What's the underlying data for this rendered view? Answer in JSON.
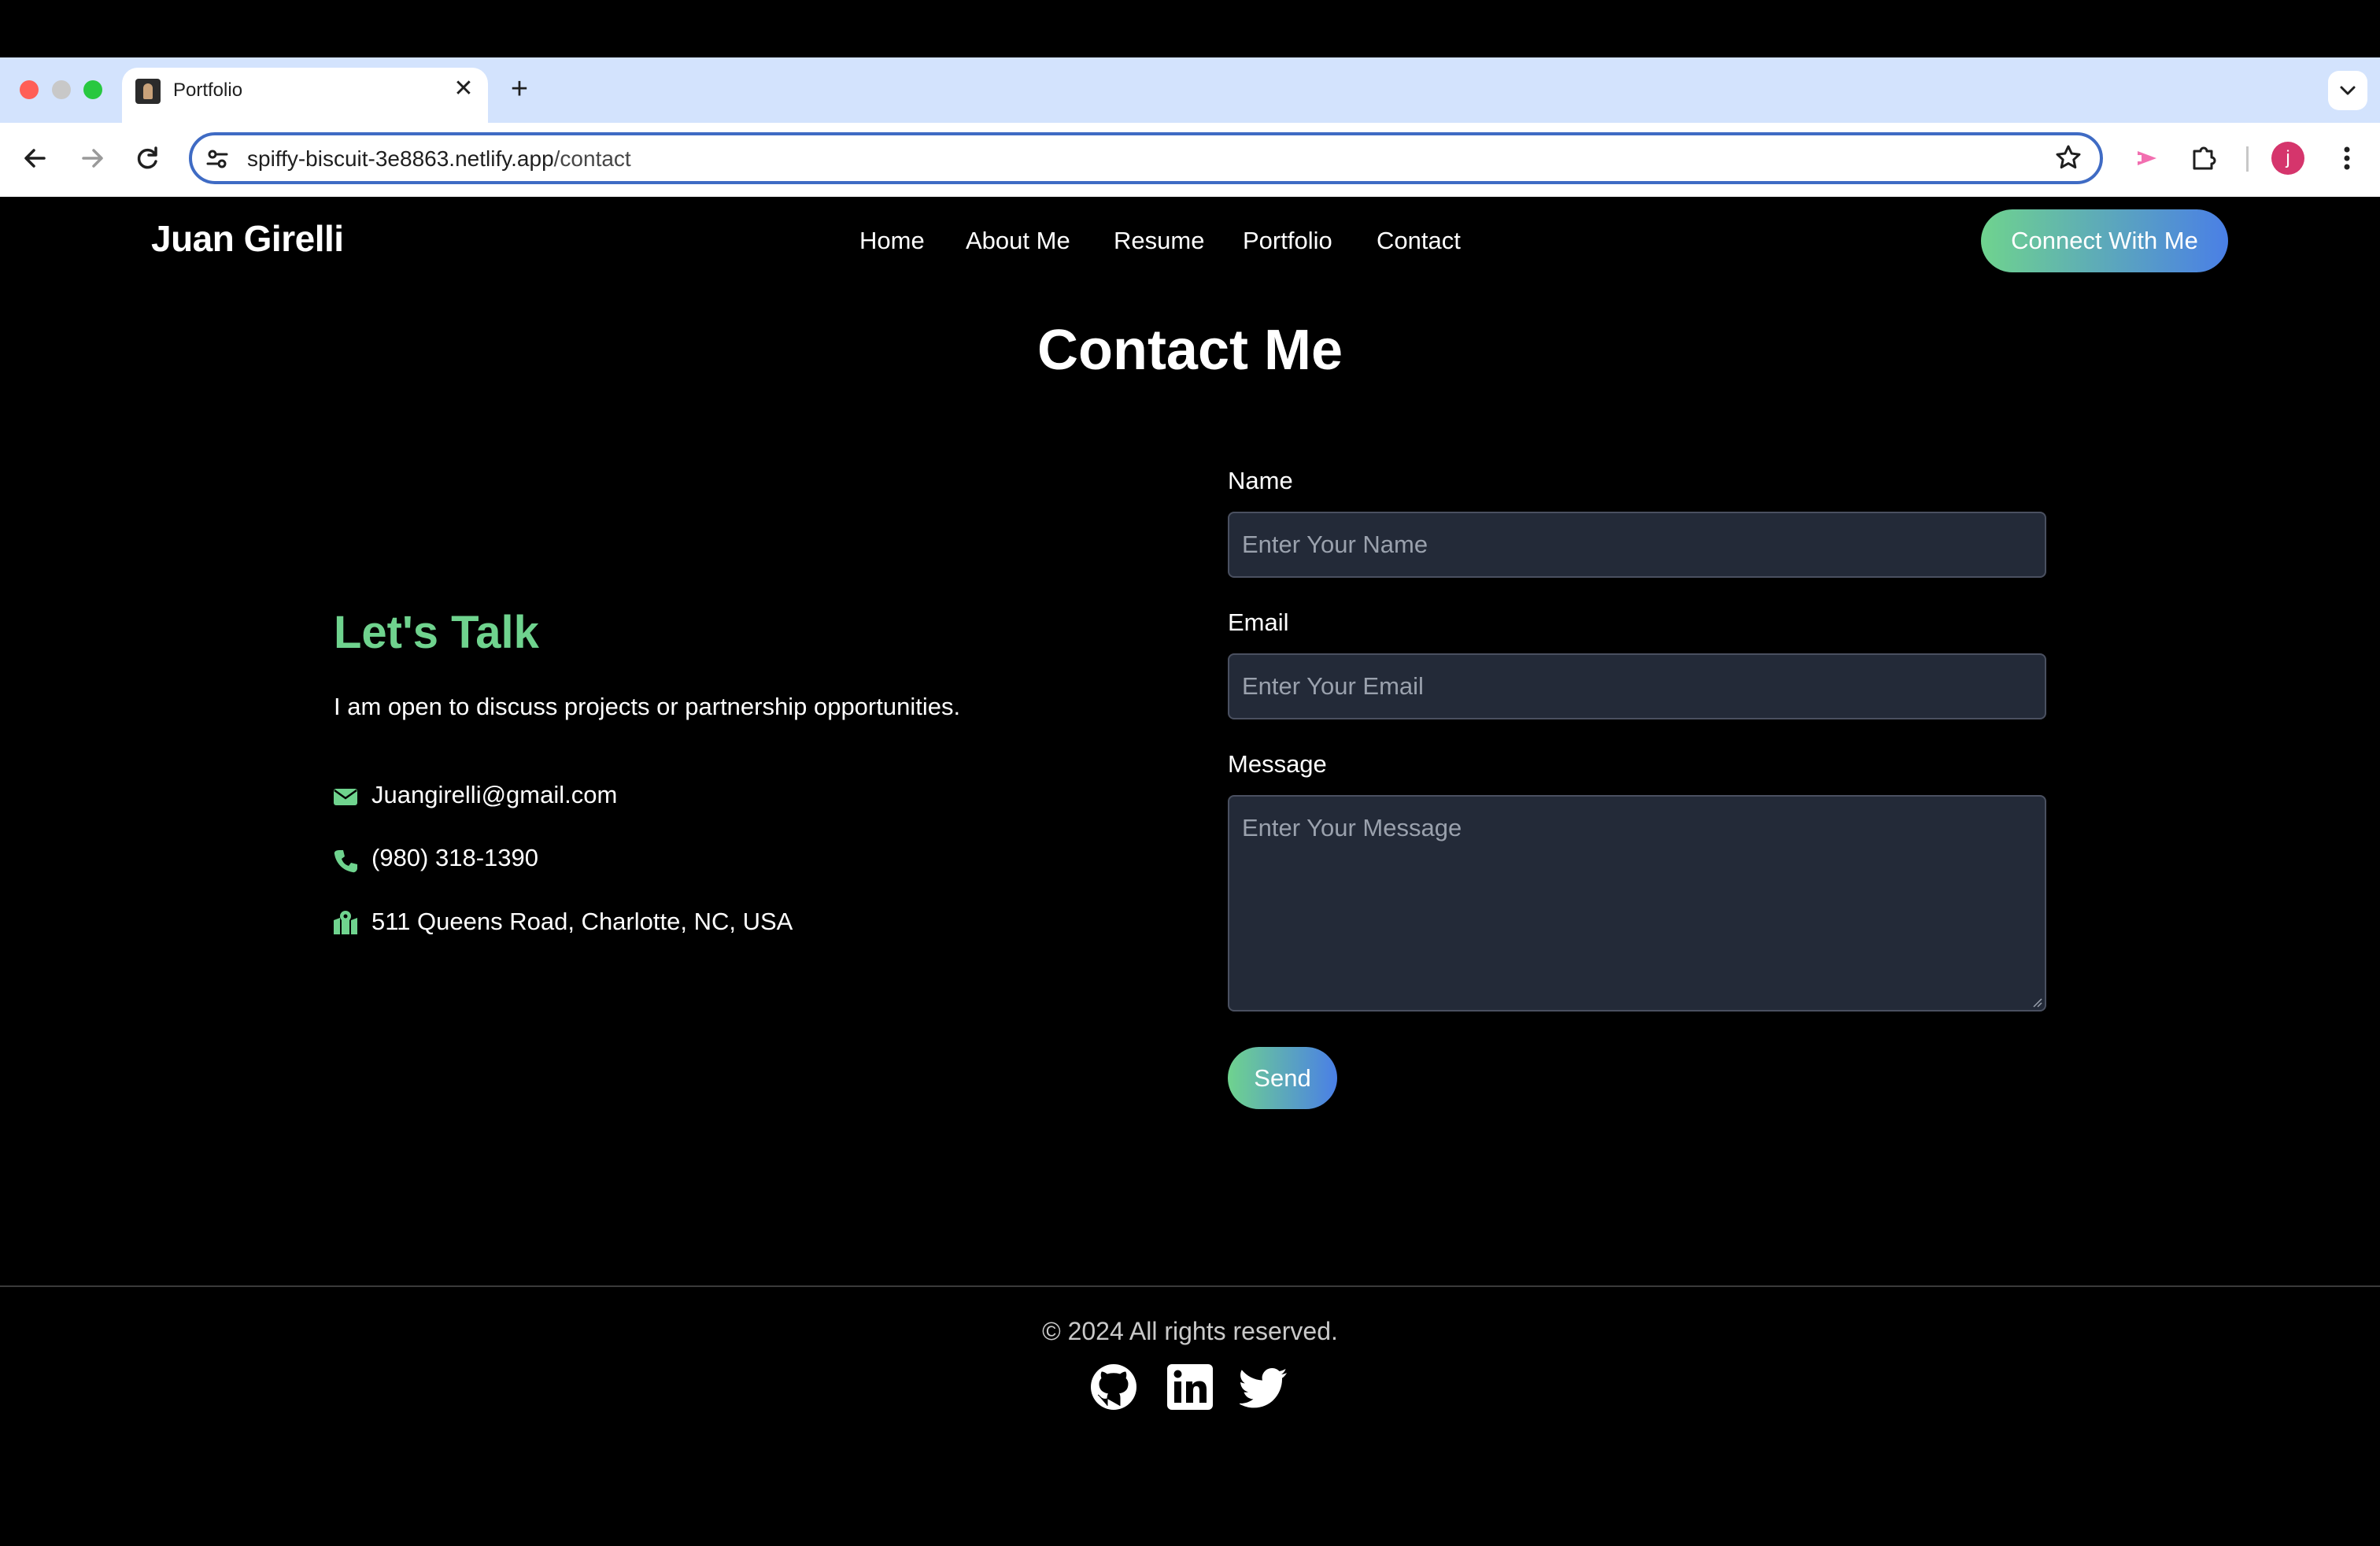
{
  "browser": {
    "tab_title": "Portfolio",
    "close_glyph": "✕",
    "new_tab_glyph": "+",
    "url_host": "spiffy-biscuit-3e8863.netlify.app",
    "url_path": "/contact",
    "profile_initial": "j",
    "traffic_lights": [
      "#ff5f57",
      "#c8c8c8",
      "#28c840"
    ]
  },
  "site": {
    "brand": "Juan Girelli",
    "nav": [
      "Home",
      "About Me",
      "Resume",
      "Portfolio",
      "Contact"
    ],
    "cta": "Connect With Me"
  },
  "contact": {
    "title": "Contact Me",
    "heading": "Let's Talk",
    "intro": "I am open to discuss projects or partnership opportunities.",
    "email": "Juangirelli@gmail.com",
    "phone": "(980) 318-1390",
    "address": "511 Queens Road, Charlotte, NC, USA",
    "info_icons": [
      "envelope-icon",
      "phone-icon",
      "map-location-icon"
    ]
  },
  "form": {
    "name_label": "Name",
    "name_placeholder": "Enter Your Name",
    "email_label": "Email",
    "email_placeholder": "Enter Your Email",
    "message_label": "Message",
    "message_placeholder": "Enter Your Message",
    "send_label": "Send"
  },
  "footer": {
    "copyright": "© 2024 All rights reserved.",
    "social": [
      "github-icon",
      "linkedin-icon",
      "twitter-icon"
    ]
  },
  "colors": {
    "accent_green": "#6fd38e",
    "accent_blue": "#4a7fe6",
    "input_bg": "#232a38",
    "background": "#000000"
  }
}
